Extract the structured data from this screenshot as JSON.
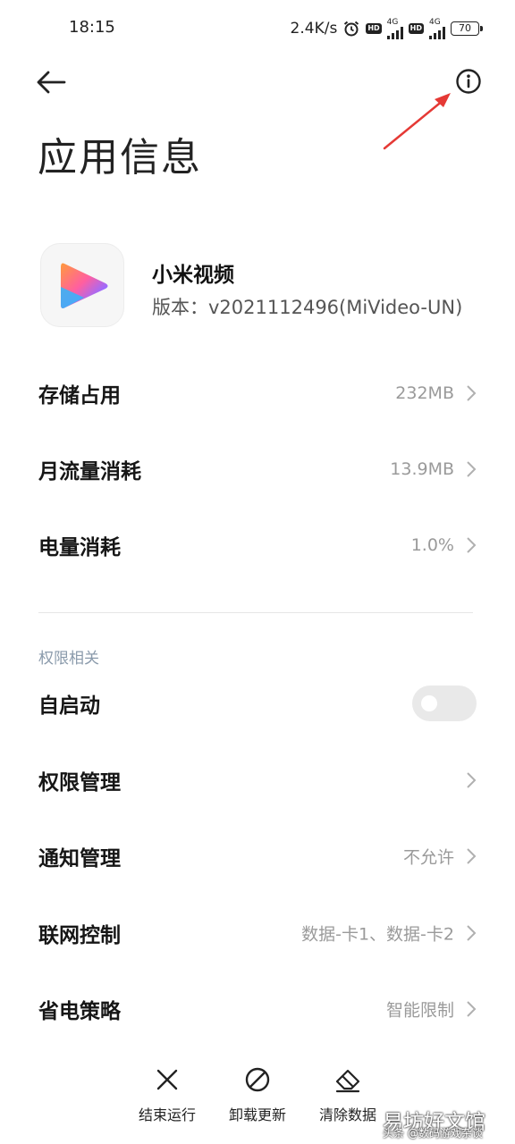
{
  "status_bar": {
    "time": "18:15",
    "speed": "2.4K/s",
    "hd1": "HD",
    "net1": "4G",
    "hd2": "HD",
    "net2": "4G",
    "battery": "70"
  },
  "header": {
    "title": "应用信息",
    "back_icon": "arrow-left-icon",
    "info_icon": "info-circle-icon"
  },
  "app": {
    "name": "小米视频",
    "version": "版本：v2021112496(MiVideo-UN)"
  },
  "rows": [
    {
      "label": "存储占用",
      "value": "232MB"
    },
    {
      "label": "月流量消耗",
      "value": "13.9MB"
    },
    {
      "label": "电量消耗",
      "value": "1.0%"
    }
  ],
  "permissions": {
    "section_title": "权限相关",
    "autostart": {
      "label": "自启动",
      "enabled": false
    },
    "items": [
      {
        "label": "权限管理",
        "value": ""
      },
      {
        "label": "通知管理",
        "value": "不允许"
      },
      {
        "label": "联网控制",
        "value": "数据-卡1、数据-卡2"
      },
      {
        "label": "省电策略",
        "value": "智能限制"
      }
    ]
  },
  "actions": [
    {
      "label": "结束运行",
      "icon": "close-x-icon"
    },
    {
      "label": "卸载更新",
      "icon": "prohibit-icon"
    },
    {
      "label": "清除数据",
      "icon": "eraser-icon"
    }
  ],
  "watermark": {
    "main": "易坊好文馆",
    "sub": "头条 @数码游戏杂谈"
  },
  "colors": {
    "accent_arrow": "#e53935",
    "section_title": "#8a9aab",
    "value_text": "#9a9a9a"
  }
}
